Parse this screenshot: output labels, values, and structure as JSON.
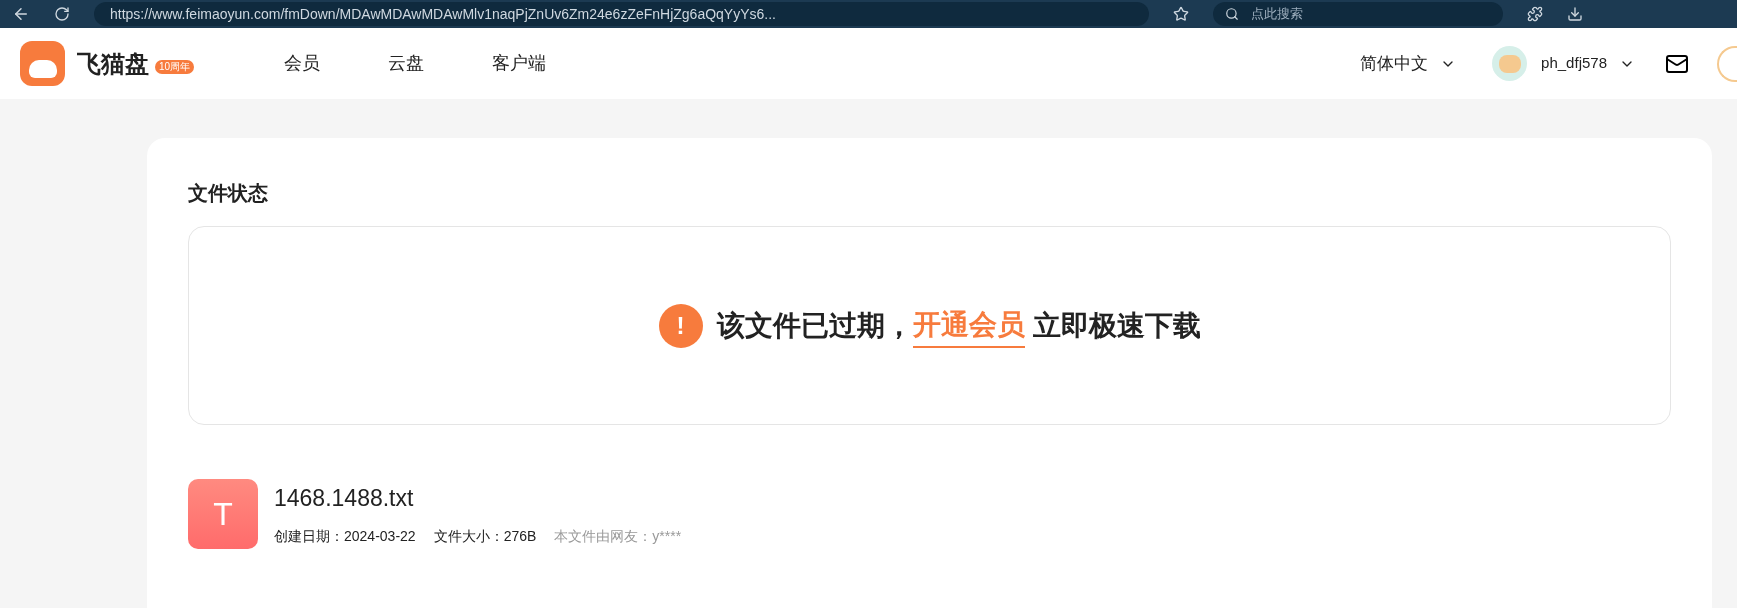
{
  "browser": {
    "url": "https://www.feimaoyun.com/fmDown/MDAwMDAwMDAwMlv1naqPjZnUv6Zm24e6zZeFnHjZg6aQqYyYs6...",
    "search_placeholder": "点此搜索"
  },
  "header": {
    "logo_text": "飞猫盘",
    "badge": "10周年",
    "nav": [
      {
        "label": "会员",
        "selected": false
      },
      {
        "label": "云盘",
        "selected": false
      },
      {
        "label": "客户端",
        "selected": false
      }
    ],
    "language": "简体中文",
    "username": "ph_dfj578"
  },
  "card": {
    "title": "文件状态",
    "notice": {
      "icon_text": "!",
      "text_before": "该文件已过期，",
      "link": "开通会员",
      "text_after": "立即极速下载"
    },
    "file": {
      "icon_letter": "T",
      "name": "1468.1488.txt",
      "created": "创建日期：2024-03-22",
      "size": "文件大小：276B",
      "shared_by": "本文件由网友：y****"
    }
  }
}
